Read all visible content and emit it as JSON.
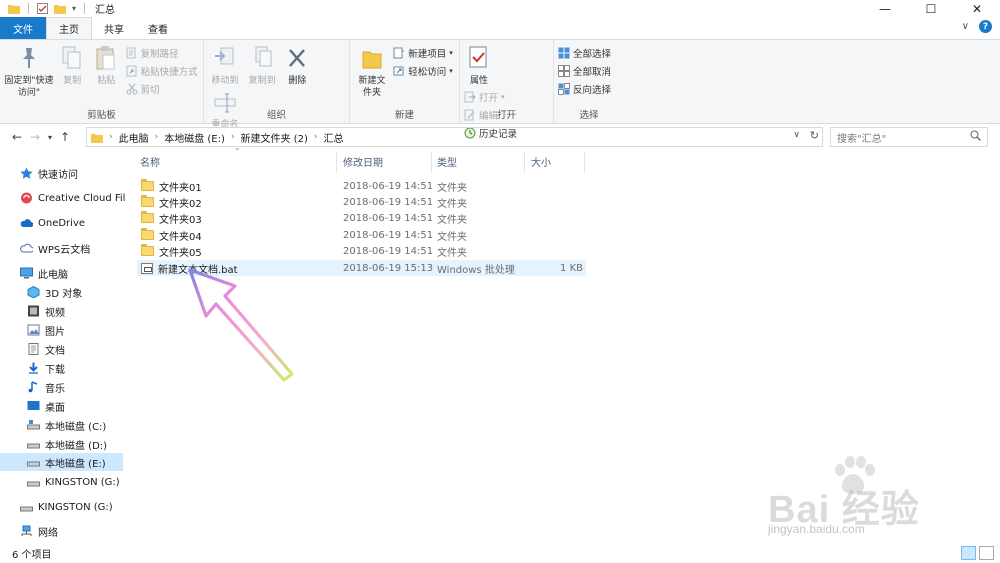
{
  "window": {
    "title": "汇总",
    "minimize_glyph": "—",
    "maximize_glyph": "☐",
    "close_glyph": "✕"
  },
  "ribbon_tabs": {
    "file": "文件",
    "home": "主页",
    "share": "共享",
    "view": "查看",
    "expand_glyph": "∨",
    "help_glyph": "?"
  },
  "ribbon": {
    "clipboard": {
      "label": "剪贴板",
      "pin": "固定到\"快速访问\"",
      "copy": "复制",
      "paste": "粘贴",
      "copy_path": "复制路径",
      "paste_shortcut": "粘贴快捷方式",
      "cut": "剪切"
    },
    "organize": {
      "label": "组织",
      "move_to": "移动到",
      "copy_to": "复制到",
      "delete": "删除",
      "rename": "重命名"
    },
    "new": {
      "label": "新建",
      "new_folder": "新建文件夹",
      "new_item": "新建项目",
      "easy_access": "轻松访问"
    },
    "open": {
      "label": "打开",
      "properties": "属性",
      "open": "打开",
      "edit": "编辑",
      "history": "历史记录"
    },
    "select": {
      "label": "选择",
      "select_all": "全部选择",
      "select_none": "全部取消",
      "invert": "反向选择"
    }
  },
  "address": {
    "crumbs": [
      "此电脑",
      "本地磁盘 (E:)",
      "新建文件夹 (2)",
      "汇总"
    ],
    "search_placeholder": "搜索\"汇总\""
  },
  "sidebar": {
    "items": [
      {
        "label": "快速访问",
        "icon": "star-icon"
      },
      {
        "label": "Creative Cloud Files",
        "icon": "creative-cloud-icon"
      },
      {
        "label": "OneDrive",
        "icon": "cloud-icon"
      },
      {
        "label": "WPS云文档",
        "icon": "wps-cloud-icon"
      },
      {
        "label": "此电脑",
        "icon": "computer-icon"
      },
      {
        "label": "3D 对象",
        "icon": "cube-icon"
      },
      {
        "label": "视频",
        "icon": "video-icon"
      },
      {
        "label": "图片",
        "icon": "picture-icon"
      },
      {
        "label": "文档",
        "icon": "document-icon"
      },
      {
        "label": "下载",
        "icon": "download-icon"
      },
      {
        "label": "音乐",
        "icon": "music-icon"
      },
      {
        "label": "桌面",
        "icon": "desktop-icon"
      },
      {
        "label": "本地磁盘 (C:)",
        "icon": "drive-c-icon"
      },
      {
        "label": "本地磁盘 (D:)",
        "icon": "drive-icon"
      },
      {
        "label": "本地磁盘 (E:)",
        "icon": "drive-icon"
      },
      {
        "label": "KINGSTON (G:)",
        "icon": "usb-drive-icon"
      },
      {
        "label": "KINGSTON (G:)",
        "icon": "usb-drive-icon"
      },
      {
        "label": "网络",
        "icon": "network-icon"
      }
    ]
  },
  "columns": {
    "name": "名称",
    "modified": "修改日期",
    "type": "类型",
    "size": "大小"
  },
  "files": [
    {
      "name": "文件夹01",
      "modified": "2018-06-19 14:51",
      "type": "文件夹",
      "size": "",
      "icon": "folder-icon"
    },
    {
      "name": "文件夹02",
      "modified": "2018-06-19 14:51",
      "type": "文件夹",
      "size": "",
      "icon": "folder-icon"
    },
    {
      "name": "文件夹03",
      "modified": "2018-06-19 14:51",
      "type": "文件夹",
      "size": "",
      "icon": "folder-icon"
    },
    {
      "name": "文件夹04",
      "modified": "2018-06-19 14:51",
      "type": "文件夹",
      "size": "",
      "icon": "folder-icon"
    },
    {
      "name": "文件夹05",
      "modified": "2018-06-19 14:51",
      "type": "文件夹",
      "size": "",
      "icon": "folder-icon"
    },
    {
      "name": "新建文本文档.bat",
      "modified": "2018-06-19 15:13",
      "type": "Windows 批处理",
      "size": "1 KB",
      "icon": "batch-file-icon"
    }
  ],
  "status": {
    "item_count": "6 个项目"
  },
  "watermark": {
    "text": "Bai 经验",
    "url": "jingyan.baidu.com"
  }
}
